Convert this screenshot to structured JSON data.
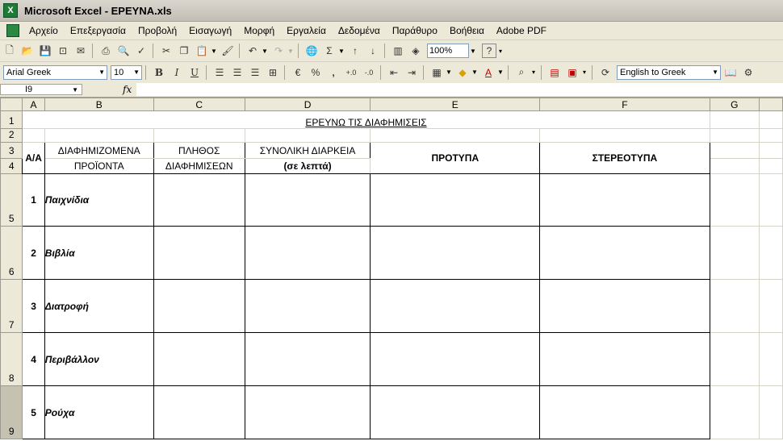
{
  "window": {
    "title": "Microsoft Excel - ΕΡΕΥΝΑ.xls"
  },
  "menu": [
    "Αρχείο",
    "Επεξεργασία",
    "Προβολή",
    "Εισαγωγή",
    "Μορφή",
    "Εργαλεία",
    "Δεδομένα",
    "Παράθυρο",
    "Βοήθεια",
    "Adobe PDF"
  ],
  "toolbar": {
    "zoom": "100%",
    "sum_symbol": "Σ",
    "help_symbol": "?"
  },
  "format": {
    "font_name": "Arial Greek",
    "font_size": "10",
    "bold": "B",
    "italic": "I",
    "underline": "U",
    "percent": "%",
    "comma": ",",
    "translate": "English to Greek"
  },
  "formula": {
    "cell_ref": "I9",
    "fx": "fx",
    "content": ""
  },
  "columns": [
    "A",
    "B",
    "C",
    "D",
    "E",
    "F",
    "G"
  ],
  "rows": [
    "1",
    "2",
    "3",
    "4",
    "5",
    "6",
    "7",
    "8",
    "9"
  ],
  "sheet": {
    "title": "ΕΡΕΥΝΩ ΤΙΣ ΔΙΑΦΗΜΙΣΕΙΣ",
    "headers": {
      "aa": "Α/Α",
      "products_1": "ΔΙΑΦΗΜΙΖΟΜΕΝΑ",
      "products_2": "ΠΡΟΪΟΝΤΑ",
      "count_1": "ΠΛΗΘΟΣ",
      "count_2": "ΔΙΑΦΗΜΙΣΕΩΝ",
      "duration_1": "ΣΥΝΟΛΙΚΗ ΔΙΑΡΚΕΙΑ",
      "duration_2": "(σε λεπτά)",
      "patterns": "ΠΡΟΤΥΠΑ",
      "stereotypes": "ΣΤΕΡΕΟΤΥΠΑ"
    },
    "items": [
      {
        "num": "1",
        "product": "Παιχνίδια"
      },
      {
        "num": "2",
        "product": "Βιβλία"
      },
      {
        "num": "3",
        "product": "Διατροφή"
      },
      {
        "num": "4",
        "product": "Περιβάλλον"
      },
      {
        "num": "5",
        "product": "Ρούχα"
      }
    ]
  }
}
